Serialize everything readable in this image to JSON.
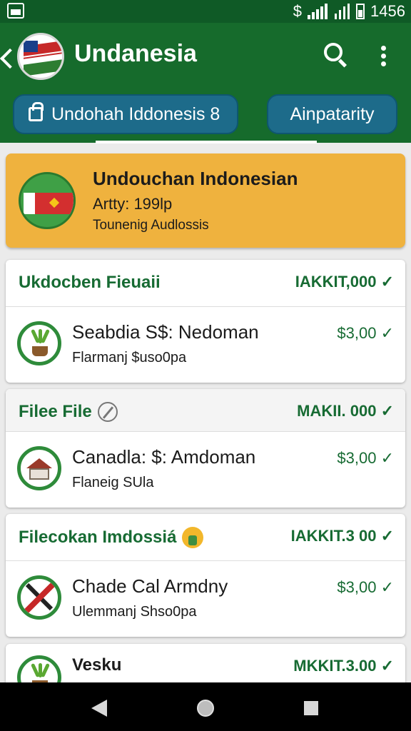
{
  "status_bar": {
    "time": "1456",
    "icons": [
      "dollar-icon",
      "wifi-icon",
      "signal-icon",
      "battery-icon"
    ]
  },
  "app_bar": {
    "title": "Undanesia",
    "tabs": [
      {
        "label": "Undohah Iddonesis 8"
      },
      {
        "label": "Ainpatarity"
      }
    ]
  },
  "hero": {
    "title": "Undouchan Indonesian",
    "subtitle": "Artty: 199lp",
    "caption": "Tounenig Audlossis"
  },
  "cards": [
    {
      "header": "Ukdocben Fieuaii",
      "header_amount": "IAKKIT,000",
      "item": {
        "title": "Seabdia S$: Nedoman",
        "subtitle": "Flarmanj $uso0pa",
        "amount": "$3,00"
      }
    },
    {
      "header": "Filee File",
      "header_amount": "MAKII. 000",
      "item": {
        "title": "Canadla: $: Amdoman",
        "subtitle": "Flaneig SUla",
        "amount": "$3,00"
      }
    },
    {
      "header": "Filecokan Imdossiá",
      "header_amount": "IAKKIT.3 00",
      "item": {
        "title": "Chade Cal Armdny",
        "subtitle": "Ulemmanj Shso0pa",
        "amount": "$3,00"
      }
    },
    {
      "header": "Vesku",
      "header_amount": "MKKIT.3.00"
    }
  ],
  "colors": {
    "app_bar": "#166b2c",
    "status_bar": "#0f5a26",
    "accent_green": "#176b33",
    "hero_bg": "#efb23e",
    "chip_bg": "#1d6b8a"
  }
}
